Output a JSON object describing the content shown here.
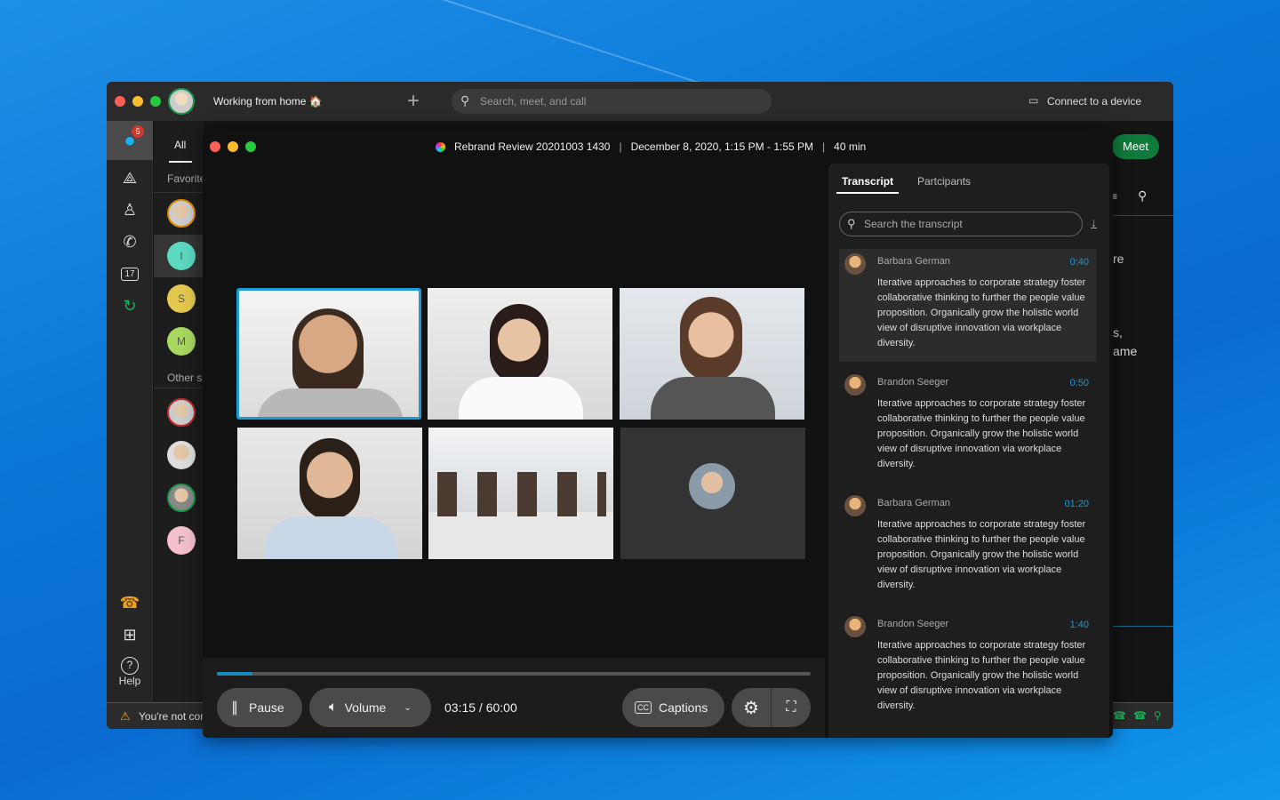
{
  "main_window": {
    "status_text": "Working from home 🏠",
    "search_placeholder": "Search, meet, and call",
    "connect_device": "Connect to a device",
    "meet_button": "Meet",
    "sidebar": {
      "messages_badge": "5",
      "calendar_day": "17",
      "help_label": "Help"
    },
    "contacts": {
      "tab_all": "All",
      "section_favorites": "Favorites",
      "section_other": "Other spaces",
      "initials": [
        "I",
        "S",
        "M",
        "F"
      ]
    },
    "background_text": [
      "re",
      "s,",
      "ame"
    ],
    "warning": "You're not connected"
  },
  "meeting": {
    "title": "Rebrand Review 20201003 1430",
    "datetime": "December 8, 2020, 1:15 PM - 1:55 PM",
    "duration": "40 min",
    "progress_percent": 6,
    "controls": {
      "pause": "Pause",
      "volume": "Volume",
      "time": "03:15 / 60:00",
      "captions": "Captions"
    },
    "tabs": [
      "Transcript",
      "Partcipants"
    ],
    "transcript_search_placeholder": "Search the transcript",
    "transcript": [
      {
        "name": "Barbara German",
        "time": "0:40",
        "text": "Iterative approaches to corporate strategy foster collaborative thinking to further the people value proposition. Organically grow the holistic world view of disruptive innovation via workplace diversity."
      },
      {
        "name": "Brandon Seeger",
        "time": "0:50",
        "text": "Iterative approaches to corporate strategy foster collaborative thinking to further the people value proposition. Organically grow the holistic world view of disruptive innovation via workplace diversity."
      },
      {
        "name": "Barbara German",
        "time": "01:20",
        "text": "Iterative approaches to corporate strategy foster collaborative thinking to further the people value proposition. Organically grow the holistic world view of disruptive innovation via workplace diversity."
      },
      {
        "name": "Brandon Seeger",
        "time": "1:40",
        "text": "Iterative approaches to corporate strategy foster collaborative thinking to further the people value proposition. Organically grow the holistic world view of disruptive innovation via workplace diversity."
      }
    ]
  },
  "colors": {
    "accent": "#1a9ad6",
    "meet_green": "#0f7b3a",
    "badge_red": "#d0382b"
  }
}
